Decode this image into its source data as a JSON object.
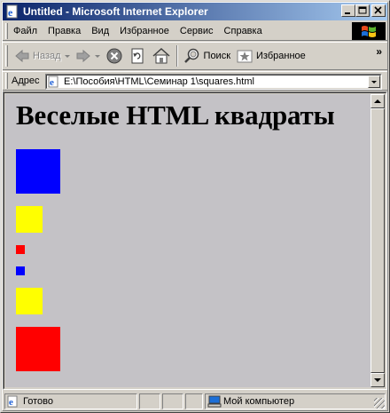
{
  "window": {
    "title": "Untitled - Microsoft Internet Explorer",
    "buttons": {
      "minimize": "_",
      "maximize": "□",
      "close": "×"
    }
  },
  "menu": {
    "items": [
      {
        "label": "Файл"
      },
      {
        "label": "Правка"
      },
      {
        "label": "Вид"
      },
      {
        "label": "Избранное"
      },
      {
        "label": "Сервис"
      },
      {
        "label": "Справка"
      }
    ]
  },
  "toolbar": {
    "back_label": "Назад",
    "forward_icon": "forward-arrow-icon",
    "stop_icon": "stop-icon",
    "refresh_icon": "refresh-icon",
    "home_icon": "home-icon",
    "search_label": "Поиск",
    "favorites_label": "Избранное",
    "more": "»"
  },
  "address": {
    "label": "Адрес",
    "value": "E:\\Пособия\\HTML\\Семинар 1\\squares.html"
  },
  "page": {
    "heading": "Веселые HTML квадраты",
    "background": "#c4c2c6",
    "squares": [
      {
        "color": "#0000ff"
      },
      {
        "color": "#ffff00"
      },
      {
        "color": "#ff0000"
      },
      {
        "color": "#0000ff"
      },
      {
        "color": "#ffff00"
      },
      {
        "color": "#ff0000"
      }
    ]
  },
  "status": {
    "text": "Готово",
    "zone": "Мой компьютер"
  }
}
